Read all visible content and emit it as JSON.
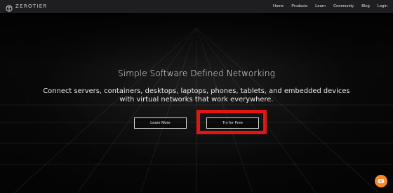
{
  "header": {
    "brand": "ZEROTIER",
    "nav": [
      {
        "label": "Home"
      },
      {
        "label": "Products"
      },
      {
        "label": "Learn"
      },
      {
        "label": "Community"
      },
      {
        "label": "Blog"
      },
      {
        "label": "Login"
      }
    ]
  },
  "hero": {
    "title": "Simple Software Defined Networking",
    "subtitle_line1": "Connect servers, containers, desktops, laptops, phones, tablets, and embedded devices",
    "subtitle_line2": "with virtual networks that work everywhere."
  },
  "buttons": {
    "learn_more": "Learn More",
    "try_for_free": "Try for Free"
  },
  "colors": {
    "nav_bg": "#1e1e20",
    "highlight": "#e01515",
    "chat": "#f28a2e"
  },
  "icons": {
    "brand": "zerotier-logo-icon",
    "chat": "chat-bubble-icon"
  }
}
